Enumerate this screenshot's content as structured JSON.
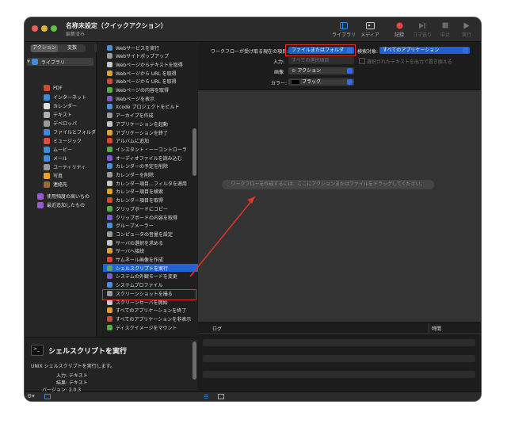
{
  "window": {
    "title": "名称未設定（クイックアクション）",
    "subtitle": "編集済み"
  },
  "toolbar": {
    "library": "ライブラリ",
    "media": "メディア",
    "record": "記録",
    "step": "コマ送り",
    "stop": "中止",
    "run": "実行"
  },
  "sidebar": {
    "tab_actions": "アクション",
    "tab_variables": "変数",
    "search_placeholder": "名前",
    "library_label": "ライブラリ",
    "items": [
      "PDF",
      "インターネット",
      "カレンダー",
      "テキスト",
      "デベロッパ",
      "ファイルとフォルダ",
      "ミュージック",
      "ムービー",
      "メール",
      "ユーティリティ",
      "写真",
      "連絡先",
      "使用頻度の高いもの",
      "最近追加したもの"
    ]
  },
  "actions": [
    "Webサービスを実行",
    "Webサイトポップアップ",
    "Webページからテキストを取得",
    "Webページから URL を取得",
    "Webページから URL を取得",
    "Webページの内容を取得",
    "Webページを表示",
    "Xcode プロジェクトをビルド",
    "アーカイブを作成",
    "アプリケーションを起動",
    "アプリケーションを終了",
    "アルバムに追加",
    "インスタント・ーーコントローラ",
    "オーディオファイルを読み込む",
    "カレンダーの予定を削除",
    "カレンダーを削除",
    "カレンダー項目…フィルタを適用",
    "カレンダー項目を検索",
    "カレンダー項目を取得",
    "クリップボードにコピー",
    "クリップボードの内容を取得",
    "グループメーラー",
    "コンピュータの音量を設定",
    "サーバの選択を求める",
    "サーバへ接続",
    "サムネール画像を作成",
    "シェルスクリプトを実行",
    "システムの外観モードを変更",
    "システムプロファイル",
    "スクリーンショットを撮る",
    "スクリーンセーバを開始",
    "すべてのアプリケーションを終了",
    "すべてのアプリケーションを非表示",
    "ディスクイメージをマウント"
  ],
  "selected_action": "シェルスクリプトを実行",
  "description": {
    "title": "シェルスクリプトを実行",
    "body": "UNIX シェルスクリプトを実行します。",
    "input_label": "入力:",
    "input_value": "テキスト",
    "result_label": "結果:",
    "result_value": "テキスト",
    "version_label": "バージョン:",
    "version_value": "2.0.3"
  },
  "workflow": {
    "receives_label": "ワークフローが受け取る現在の項目:",
    "receives_value": "ファイルまたはフォルダ",
    "target_label": "検索対象:",
    "target_value": "すべてのアプリケーション",
    "input_label": "入力:",
    "input_value": "すべての選択項目",
    "replace_label": "選択されたテキストを出力で置き換える",
    "image_label": "画像",
    "image_value": "アクション",
    "color_label": "カラー:",
    "color_value": "ブラック"
  },
  "canvas_hint": "ワークフローを作成するには、ここにアクションまたはファイルをドラッグしてください。",
  "log": {
    "col_log": "ログ",
    "col_time": "時間"
  },
  "colors": {
    "accent": "#1f63d6",
    "highlight": "#e0332a",
    "record": "#e8473f"
  }
}
